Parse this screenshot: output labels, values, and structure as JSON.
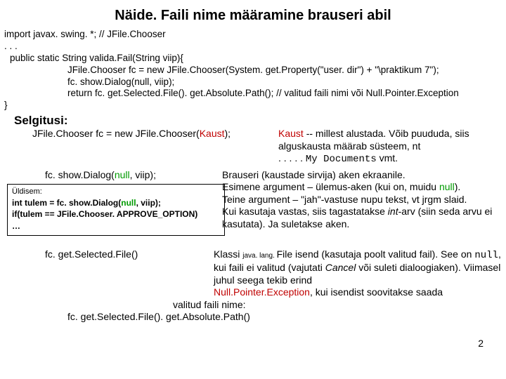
{
  "title": "Näide. Faili nime määramine brauseri abil",
  "code": {
    "l1": "import javax. swing. *; // JFile.Chooser",
    "l2": ". . . ",
    "l3": " public static String valida.Fail(String viip){",
    "l4": "JFile.Chooser fc = new JFile.Chooser(System. get.Property(\"user. dir\") + \"\\praktikum 7\");",
    "l5": "fc. show.Dialog(null, viip);",
    "l6": "return fc. get.Selected.File(). get.Absolute.Path(); // valitud faili nimi või Null.Pointer.Exception",
    "l7": "}"
  },
  "selgitusi_label": "Selgitusi:",
  "sec1": {
    "left": {
      "pre": "JFile.Chooser fc = new JFile.Chooser(",
      "arg": "Kaust",
      "post": ");"
    },
    "right": {
      "kaust": "Kaust",
      "rest1": " -- millest alustada. Võib puududa, siis alguskausta määrab süsteem, nt ",
      "dots": ". . . . . ",
      "mydocs": "My Documents",
      "rest2": " vmt."
    }
  },
  "sec2": {
    "show_pre": "fc. show.Dialog(",
    "show_null": "null",
    "show_post": ", viip);",
    "box": {
      "hdr": "Üldisem:",
      "l1a": "int tulem = fc. show.Dialog(",
      "l1b": "null",
      "l1c": ", viip);",
      "l2": "if(tulem == JFile.Chooser. APPROVE_OPTION)",
      "l3": "   …"
    },
    "right": {
      "r1a": "Brauseri (kaustade sirvija) aken ekraanile.",
      "r2a": "Esimene argument – ülemus-aken (kui on, muidu ",
      "r2_null": "null",
      "r2b": ").",
      "r3": "Teine argument – \"jah\"-vastuse nupu tekst, vt jrgm slaid.",
      "r4a": "Kui kasutaja vastas, siis tagastatakse ",
      "r4_int": "int",
      "r4b": "-arv (siin seda arvu ei kasutata). Ja suletakse aken."
    }
  },
  "sec3": {
    "left": "fc. get.Selected.File()",
    "right": {
      "r1a": "Klassi ",
      "r1_small": "java. lang. ",
      "r1b": "File isend (kasutaja poolt valitud fail). See on ",
      "r1_null": "null",
      "r1c": ", kui faili ei valitud (vajutati ",
      "r1_cancel": "Cancel",
      "r1d": " või suleti dialoogiaken). Viimasel juhul seega tekib erind ",
      "npe": "Null.Pointer.Exception",
      "r1e": ", kui isendist soovitakse saada"
    }
  },
  "valitud": "valitud faili nime:",
  "lastline": "fc. get.Selected.File(). get.Absolute.Path()",
  "pagenum": "2"
}
